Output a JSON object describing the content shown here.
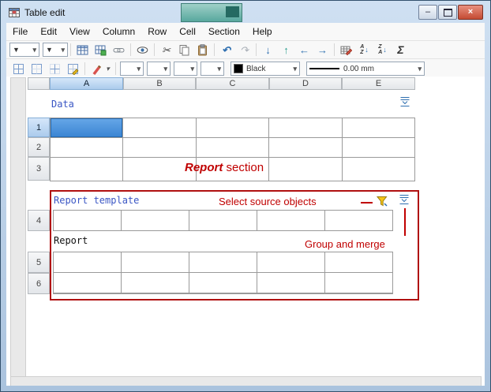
{
  "window": {
    "title": "Table edit",
    "minimize_glyph": "–",
    "close_glyph": "×"
  },
  "menu": {
    "items": [
      "File",
      "Edit",
      "View",
      "Column",
      "Row",
      "Cell",
      "Section",
      "Help"
    ]
  },
  "toolbar": {
    "color_select": {
      "value": "Black",
      "swatch_style": "background:#000000"
    },
    "line_select": {
      "value": "0.00 mm"
    },
    "icons": {
      "dropdown": "▼",
      "dropdown_small": "▾",
      "scissors": "✂",
      "undo": "↶",
      "redo": "↷",
      "arrow_down": "↓",
      "arrow_up": "↑",
      "arrow_left": "←",
      "arrow_right": "→",
      "sort_a": "A",
      "sort_z": "Z",
      "sort_arrow": "↓",
      "sigma": "Σ"
    }
  },
  "grid": {
    "columns": [
      "A",
      "B",
      "C",
      "D",
      "E"
    ],
    "rows": [
      "1",
      "2",
      "3",
      "4",
      "5",
      "6"
    ]
  },
  "labels": {
    "data": "Data",
    "report_template": "Report template",
    "report": "Report"
  },
  "annotations": {
    "report_section_bold": "Report",
    "report_section_rest": " section",
    "select_source_objects": "Select source objects",
    "group_and_merge": "Group and merge"
  },
  "colors": {
    "annotation_red": "#c00000",
    "label_blue": "#3a56c4",
    "selection_blue": "#3d86d0",
    "report_box_border": "#b01010",
    "swatch_black": "#000000"
  }
}
